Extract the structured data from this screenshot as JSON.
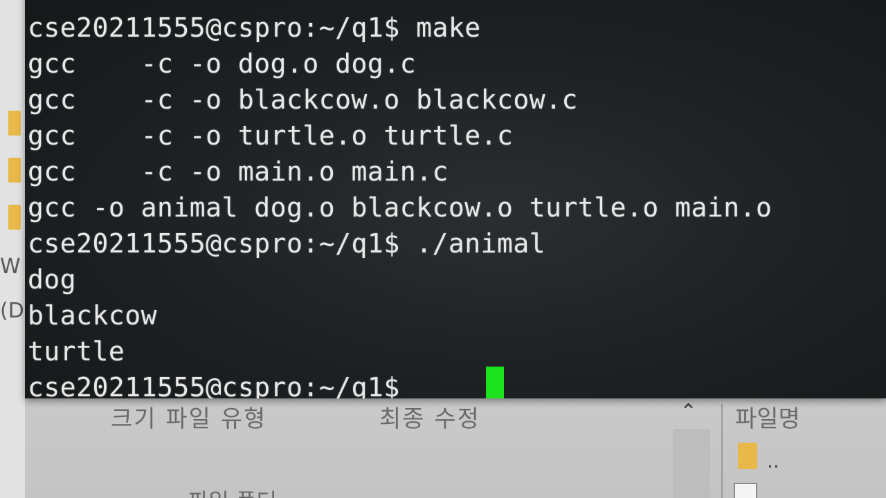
{
  "terminal": {
    "lines": [
      "cse20211555@cspro:~/q1$ make",
      "gcc    -c -o dog.o dog.c",
      "gcc    -c -o blackcow.o blackcow.c",
      "gcc    -c -o turtle.o turtle.c",
      "gcc    -c -o main.o main.c",
      "gcc -o animal dog.o blackcow.o turtle.o main.o",
      "cse20211555@cspro:~/q1$ ./animal",
      "dog",
      "blackcow",
      "turtle",
      "cse20211555@cspro:~/q1$ "
    ],
    "cursor_color": "#1be21b"
  },
  "file_manager": {
    "left_letter_1": "W",
    "left_letter_2": "(D",
    "col_headers": [
      "크기 파일 유형",
      "최종 수정"
    ],
    "right_header": "파일명",
    "parent_dir": "..",
    "bottom_text": "파일 폴더",
    "sort_icon": "chevron-up-icon"
  }
}
